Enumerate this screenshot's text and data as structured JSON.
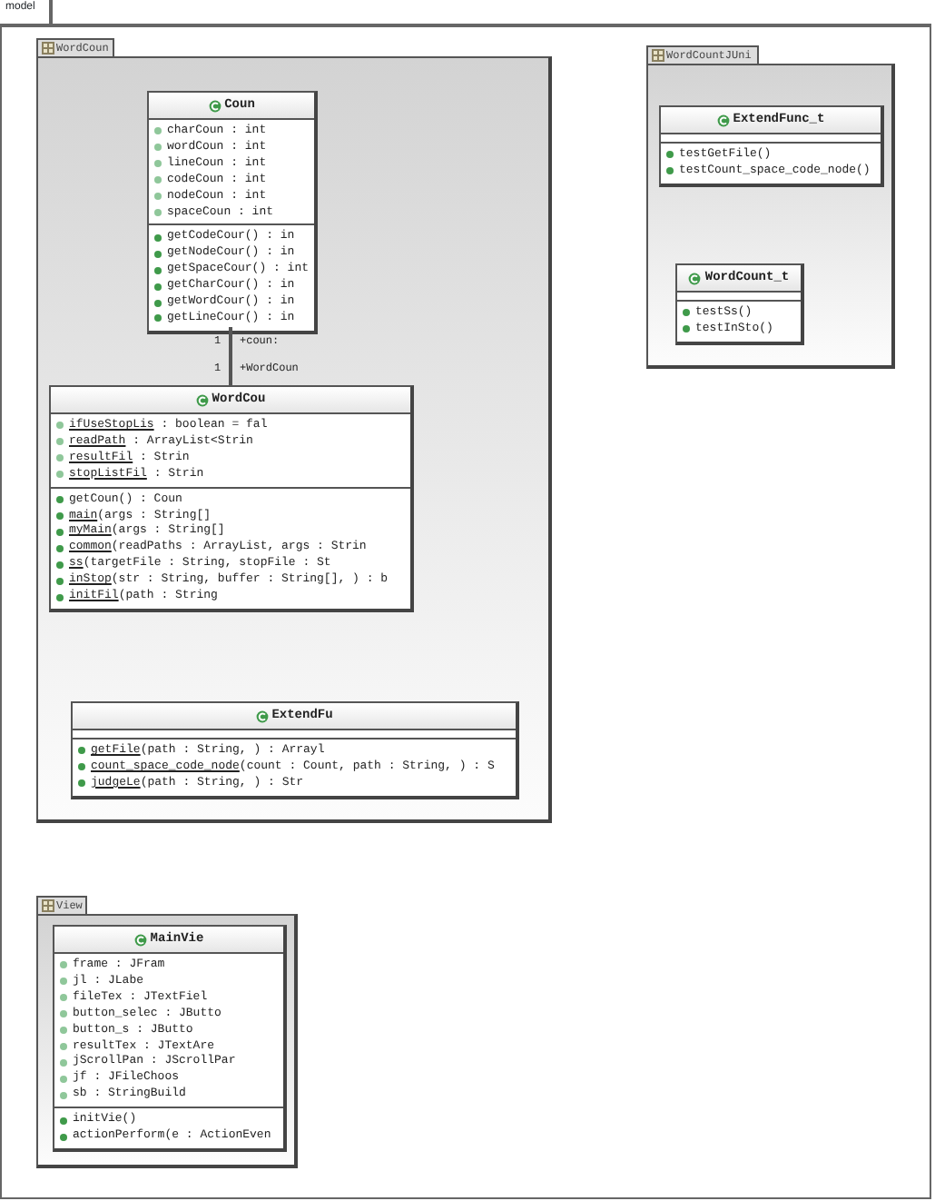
{
  "diagram_title": "model",
  "packages": [
    {
      "name": "WordCoun",
      "classes": [
        {
          "name": "Coun",
          "attributes": [
            {
              "text": "charCoun : int",
              "static": false
            },
            {
              "text": "wordCoun : int",
              "static": false
            },
            {
              "text": "lineCoun : int",
              "static": false
            },
            {
              "text": "codeCoun : int",
              "static": false
            },
            {
              "text": "nodeCoun : int",
              "static": false
            },
            {
              "text": "spaceCoun : int",
              "static": false
            }
          ],
          "methods": [
            {
              "text": "getCodeCour() : in",
              "static": false
            },
            {
              "text": "getNodeCour() : in",
              "static": false
            },
            {
              "text": "getSpaceCour() : int",
              "static": false
            },
            {
              "text": "getCharCour() : in",
              "static": false
            },
            {
              "text": "getWordCour() : in",
              "static": false
            },
            {
              "text": "getLineCour() : in",
              "static": false
            }
          ]
        },
        {
          "name": "WordCou",
          "attributes": [
            {
              "text": "ifUseStopLis : boolean = fal",
              "static": true
            },
            {
              "text": "readPath : ArrayList<Strin",
              "static": true
            },
            {
              "text": "resultFil : Strin",
              "static": true
            },
            {
              "text": "stopListFil : Strin",
              "static": true
            }
          ],
          "methods": [
            {
              "text": "getCoun() : Coun",
              "static": false
            },
            {
              "text": "main(args : String[]",
              "static": true
            },
            {
              "text": "myMain(args : String[]",
              "static": true
            },
            {
              "text": "common(readPaths : ArrayList, args : Strin",
              "static": true
            },
            {
              "text": "ss(targetFile : String, stopFile : St",
              "static": true
            },
            {
              "text": "inStop(str : String, buffer : String[], ) : b",
              "static": true
            },
            {
              "text": "initFil(path : String",
              "static": true
            }
          ]
        },
        {
          "name": "ExtendFu",
          "methods": [
            {
              "text": "getFile(path : String, ) : Arrayl",
              "static": true
            },
            {
              "text": "count_space_code_node(count : Count, path : String, ) : S",
              "static": true
            },
            {
              "text": "judgeLe(path : String, ) : Str",
              "static": true
            }
          ]
        }
      ]
    },
    {
      "name": "WordCountJUni",
      "classes": [
        {
          "name": "ExtendFunc_t",
          "methods": [
            {
              "text": "testGetFile()",
              "static": false
            },
            {
              "text": "testCount_space_code_node()",
              "static": false
            }
          ]
        },
        {
          "name": "WordCount_t",
          "methods": [
            {
              "text": "testSs()",
              "static": false
            },
            {
              "text": "testInSto()",
              "static": false
            }
          ]
        }
      ]
    },
    {
      "name": "View",
      "classes": [
        {
          "name": "MainVie",
          "attributes": [
            {
              "text": "frame : JFram",
              "static": false
            },
            {
              "text": "jl : JLabe",
              "static": false
            },
            {
              "text": "fileTex : JTextFiel",
              "static": false
            },
            {
              "text": "button_selec : JButto",
              "static": false
            },
            {
              "text": "button_s : JButto",
              "static": false
            },
            {
              "text": "resultTex : JTextAre",
              "static": false
            },
            {
              "text": "jScrollPan : JScrollPar",
              "static": false
            },
            {
              "text": "jf : JFileChoos",
              "static": false
            },
            {
              "text": "sb : StringBuild",
              "static": false
            }
          ],
          "methods": [
            {
              "text": "initVie()",
              "static": false
            },
            {
              "text": "actionPerform(e : ActionEven",
              "static": false
            }
          ]
        }
      ]
    }
  ],
  "associations": [
    {
      "ends": [
        {
          "multiplicity": "1",
          "role": "+coun:"
        },
        {
          "multiplicity": "1",
          "role": "+WordCoun"
        }
      ]
    }
  ]
}
